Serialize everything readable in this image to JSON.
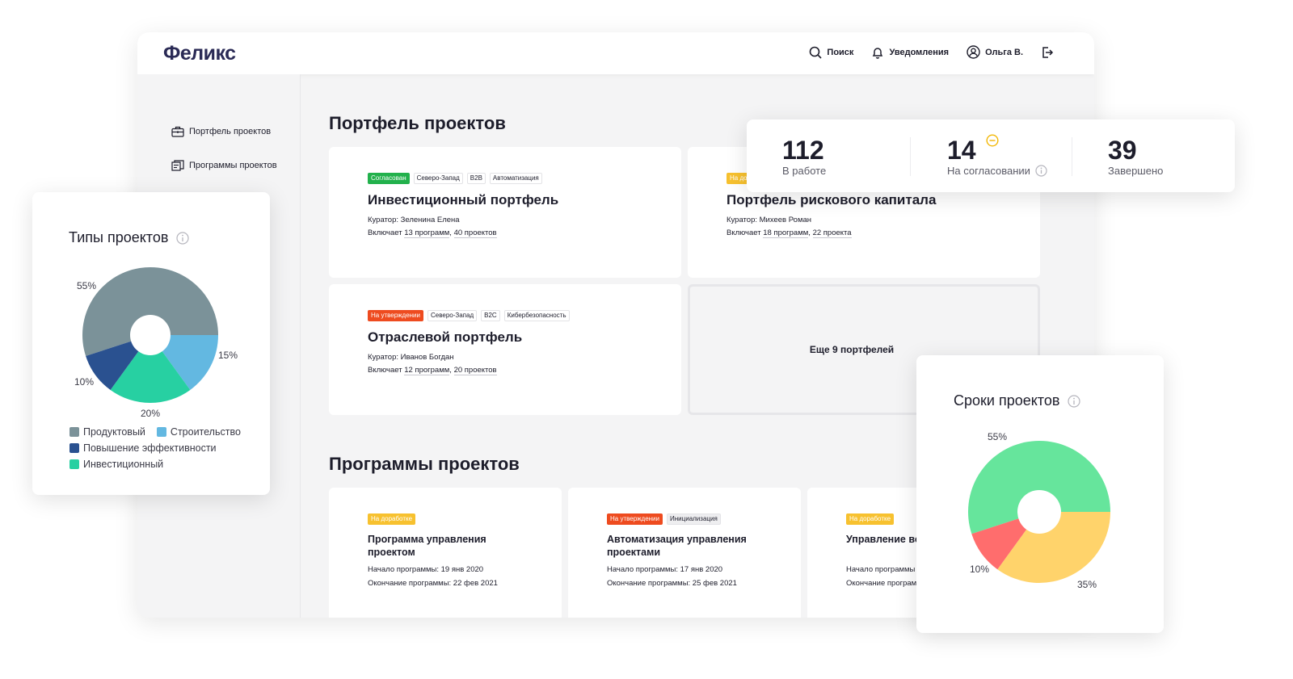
{
  "app": {
    "logo": "Феликс",
    "nav": {
      "search": "Поиск",
      "notifications": "Уведомления",
      "user": "Ольга В."
    }
  },
  "sidebar": {
    "items": [
      {
        "label": "Портфель проектов",
        "icon": "briefcase-icon"
      },
      {
        "label": "Программы проектов",
        "icon": "programs-icon"
      }
    ]
  },
  "portfolio": {
    "title": "Портфель проектов",
    "cards": [
      {
        "tags": [
          {
            "text": "Согласован",
            "kind": "green"
          },
          {
            "text": "Северо-Запад"
          },
          {
            "text": "B2B"
          },
          {
            "text": "Автоматизация"
          }
        ],
        "title": "Инвестиционный портфель",
        "curator": "Куратор: Зеленина Елена",
        "includes_prefix": "Включает ",
        "includes_programs": "13 программ",
        "includes_sep": ", ",
        "includes_projects": "40 проектов"
      },
      {
        "tags": [
          {
            "text": "На доработке",
            "kind": "yellow"
          }
        ],
        "title": "Портфель рискового капитала",
        "curator": "Куратор: Михеев Роман",
        "includes_prefix": "Включает ",
        "includes_programs": "18 программ",
        "includes_sep": ", ",
        "includes_projects": "22 проекта"
      },
      {
        "tags": [
          {
            "text": "На утверждении",
            "kind": "red"
          },
          {
            "text": "Северо-Запад"
          },
          {
            "text": "B2C"
          },
          {
            "text": "Кибербезопасность"
          }
        ],
        "title": "Отраслевой портфель",
        "curator": "Куратор: Иванов Богдан",
        "includes_prefix": "Включает ",
        "includes_programs": "12 программ",
        "includes_sep": ", ",
        "includes_projects": "20 проектов"
      }
    ],
    "more": "Еще 9 портфелей"
  },
  "programs": {
    "title": "Программы проектов",
    "cards": [
      {
        "tags": [
          {
            "text": "На доработке",
            "kind": "yellow"
          }
        ],
        "title": "Программа управления проектом",
        "start": "Начало программы: 19 янв 2020",
        "end": "Окончание программы: 22 фев 2021"
      },
      {
        "tags": [
          {
            "text": "На утверждении",
            "kind": "red"
          },
          {
            "text": "Инициализация"
          }
        ],
        "title": "Автоматизация управления проектами",
        "start": "Начало программы: 17 янв 2020",
        "end": "Окончание программы: 25 фев 2021"
      },
      {
        "tags": [
          {
            "text": "На доработке",
            "kind": "yellow"
          }
        ],
        "title": "Управление во программами",
        "start": "Начало программы",
        "end": "Окончание програм"
      }
    ]
  },
  "stats": {
    "in_work": {
      "value": "112",
      "label": "В работе"
    },
    "approval": {
      "value": "14",
      "label": "На согласовании"
    },
    "done": {
      "value": "39",
      "label": "Завершено"
    }
  },
  "chart_data": [
    {
      "type": "pie",
      "title": "Типы проектов",
      "labels": [
        "Продуктовый",
        "Строительство",
        "Инвестиционный",
        "Повышение эффективности"
      ],
      "values": [
        55,
        15,
        20,
        10
      ],
      "colors": [
        "#7b9299",
        "#63b8e1",
        "#27d0a2",
        "#2a5190"
      ],
      "legend": [
        [
          "Продуктовый",
          "Строительство"
        ],
        [
          "Повышение эффективности"
        ],
        [
          "Инвестиционный"
        ]
      ],
      "legend_colors": {
        "Продуктовый": "#7b9299",
        "Строительство": "#63b8e1",
        "Повышение эффективности": "#2a5190",
        "Инвестиционный": "#27d0a2"
      },
      "legend_placement": "bottom"
    },
    {
      "type": "pie",
      "title": "Сроки проектов",
      "values": [
        55,
        35,
        10
      ],
      "colors": [
        "#66e59c",
        "#ffd36b",
        "#ff6d6d"
      ],
      "legend_placement": "none"
    }
  ],
  "colors": {
    "accent": "#2a2a55",
    "status_green": "#22b14c",
    "status_red": "#ee4b1f",
    "status_yellow": "#f7c12f"
  }
}
